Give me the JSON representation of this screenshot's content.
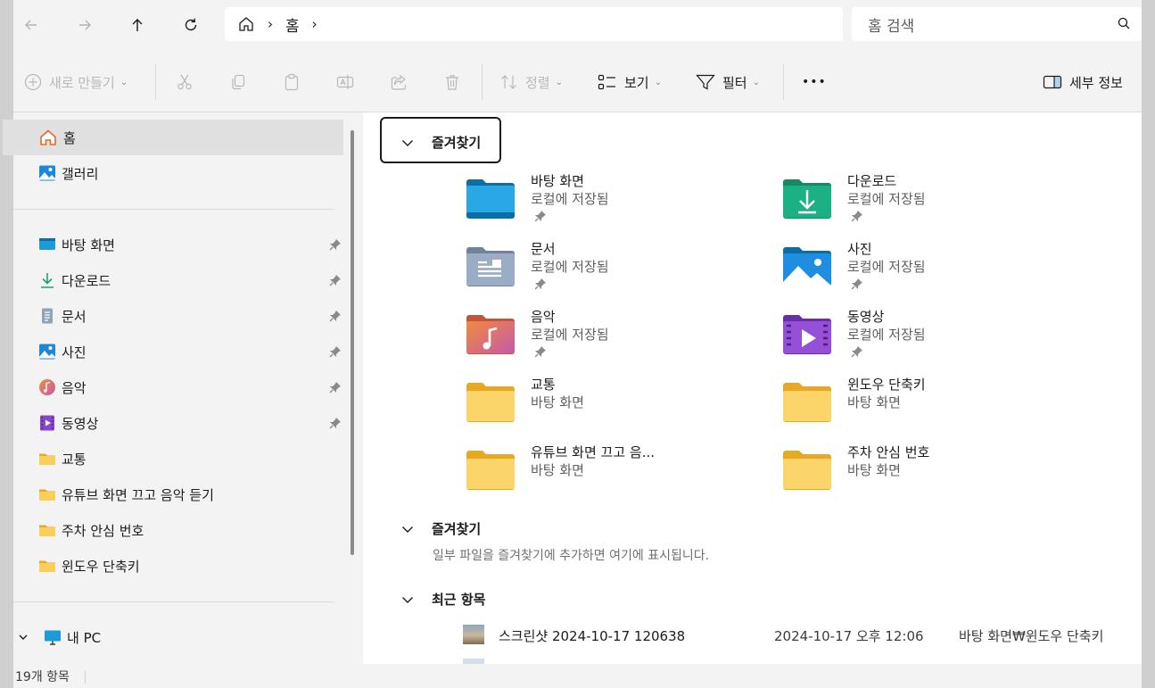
{
  "nav": {
    "address": {
      "home_label": "홈"
    },
    "search_placeholder": "홈 검색"
  },
  "toolbar": {
    "new_label": "새로 만들기",
    "sort_label": "정렬",
    "view_label": "보기",
    "filter_label": "필터",
    "more_label": "•••",
    "details_label": "세부 정보"
  },
  "sidebar": {
    "home": "홈",
    "gallery": "갤러리",
    "items": [
      {
        "label": "바탕 화면",
        "icon": "desktop-icon",
        "pinned": true
      },
      {
        "label": "다운로드",
        "icon": "download-icon",
        "pinned": true
      },
      {
        "label": "문서",
        "icon": "document-icon",
        "pinned": true
      },
      {
        "label": "사진",
        "icon": "pictures-icon",
        "pinned": true
      },
      {
        "label": "음악",
        "icon": "music-icon",
        "pinned": true
      },
      {
        "label": "동영상",
        "icon": "video-icon",
        "pinned": true
      },
      {
        "label": "교통",
        "icon": "folder-icon",
        "pinned": false
      },
      {
        "label": "유튜브 화면 끄고 음악 듣기",
        "icon": "folder-icon",
        "pinned": false
      },
      {
        "label": "주차 안심 번호",
        "icon": "folder-icon",
        "pinned": false
      },
      {
        "label": "윈도우 단축키",
        "icon": "folder-icon",
        "pinned": false
      }
    ],
    "this_pc": "내 PC"
  },
  "main": {
    "quick_access_title": "즐겨찾기",
    "tiles": [
      {
        "name": "바탕 화면",
        "sub": "로컬에 저장됨",
        "icon": "desktop-folder-icon",
        "pinned": true
      },
      {
        "name": "다운로드",
        "sub": "로컬에 저장됨",
        "icon": "downloads-folder-icon",
        "pinned": true
      },
      {
        "name": "문서",
        "sub": "로컬에 저장됨",
        "icon": "documents-folder-icon",
        "pinned": true
      },
      {
        "name": "사진",
        "sub": "로컬에 저장됨",
        "icon": "pictures-folder-icon",
        "pinned": true
      },
      {
        "name": "음악",
        "sub": "로컬에 저장됨",
        "icon": "music-folder-icon",
        "pinned": true
      },
      {
        "name": "동영상",
        "sub": "로컬에 저장됨",
        "icon": "videos-folder-icon",
        "pinned": true
      },
      {
        "name": "교통",
        "sub": "바탕 화면",
        "icon": "folder-icon",
        "pinned": false
      },
      {
        "name": "윈도우 단축키",
        "sub": "바탕 화면",
        "icon": "folder-icon",
        "pinned": false
      },
      {
        "name": "유튜브 화면 끄고 음...",
        "sub": "바탕 화면",
        "icon": "folder-icon",
        "pinned": false
      },
      {
        "name": "주차 안심 번호",
        "sub": "바탕 화면",
        "icon": "folder-icon",
        "pinned": false
      }
    ],
    "favorites_title": "즐겨찾기",
    "favorites_empty": "일부 파일을 즐겨찾기에 추가하면 여기에 표시됩니다.",
    "recent_title": "최근 항목",
    "recent": [
      {
        "name": "스크린샷 2024-10-17 120638",
        "date": "2024-10-17 오후 12:06",
        "location": "바탕 화면₩윈도우 단축키"
      }
    ]
  },
  "status": {
    "count": "19개 항목"
  },
  "colors": {
    "accent": "#0067c0",
    "folder_yellow": "#f5c044",
    "background": "#f3f3f3"
  }
}
